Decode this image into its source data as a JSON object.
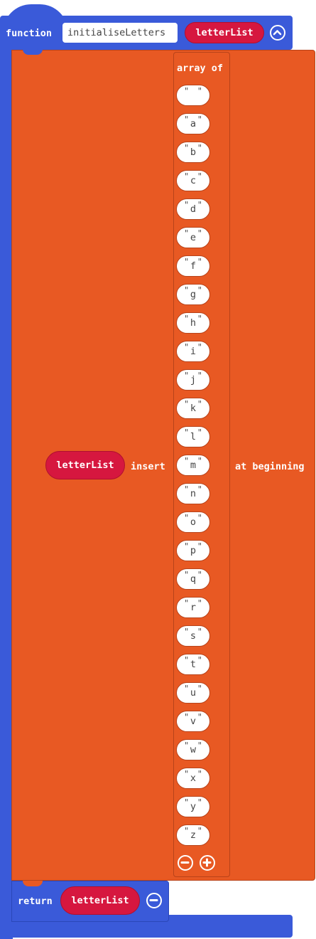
{
  "function": {
    "keyword": "function",
    "name": "initialiseLetters",
    "parameter": "letterList",
    "collapse_icon": "chevron-up-icon"
  },
  "insert": {
    "target": "letterList",
    "keyword": "insert",
    "position": "at beginning"
  },
  "array": {
    "label": "array of",
    "items": [
      " ",
      "a",
      "b",
      "c",
      "d",
      "e",
      "f",
      "g",
      "h",
      "i",
      "j",
      "k",
      "l",
      "m",
      "n",
      "o",
      "p",
      "q",
      "r",
      "s",
      "t",
      "u",
      "v",
      "w",
      "x",
      "y",
      "z"
    ],
    "remove_icon": "minus-circle-icon",
    "add_icon": "plus-circle-icon"
  },
  "return": {
    "keyword": "return",
    "value": "letterList",
    "remove_icon": "minus-circle-icon"
  },
  "colors": {
    "function_block": "#3a5ad9",
    "array_block": "#e85923",
    "variable_pill": "#d6173f"
  }
}
